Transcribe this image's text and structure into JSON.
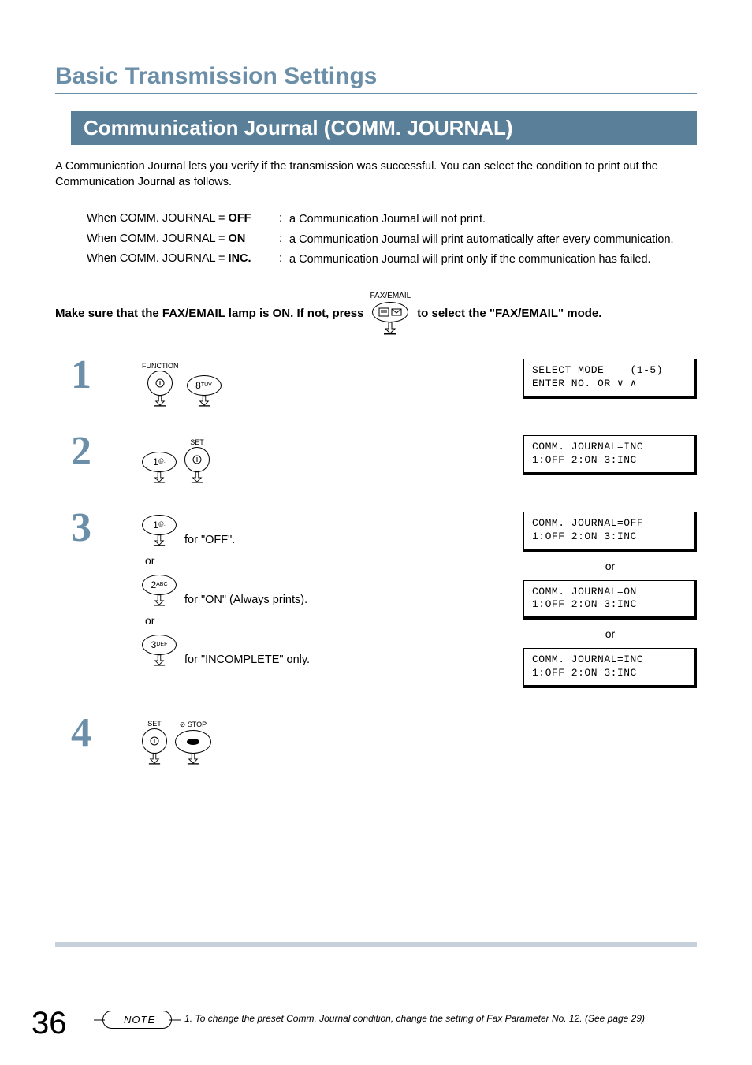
{
  "title": "Basic Transmission Settings",
  "section": "Communication Journal (COMM. JOURNAL)",
  "intro": "A Communication Journal lets you verify if the transmission was successful. You can select the condition to print out the Communication Journal as follows.",
  "conditions": [
    {
      "label_prefix": "When COMM. JOURNAL = ",
      "label_bold": "OFF",
      "desc": "a Communication Journal will not print."
    },
    {
      "label_prefix": "When COMM. JOURNAL = ",
      "label_bold": "ON",
      "desc": "a Communication Journal will print automatically after every communication."
    },
    {
      "label_prefix": "When COMM. JOURNAL = ",
      "label_bold": "INC.",
      "desc": "a Communication Journal will print only if the communication has failed."
    }
  ],
  "mode": {
    "part1": "Make sure that the FAX/EMAIL lamp is ON.  If not, press",
    "faxemail_label": "FAX/EMAIL",
    "part2": "to select the \"FAX/EMAIL\" mode."
  },
  "steps": {
    "s1": {
      "num": "1",
      "function_label": "FUNCTION",
      "key8": "8",
      "key8_sub": "TUV",
      "lcd1_l1": "SELECT MODE    (1-5)",
      "lcd1_l2": "ENTER NO. OR ∨ ∧"
    },
    "s2": {
      "num": "2",
      "key1": "1",
      "key1_sub": "@.",
      "set_label": "SET",
      "lcd_l1": "COMM. JOURNAL=INC",
      "lcd_l2": "1:OFF 2:ON 3:INC"
    },
    "s3": {
      "num": "3",
      "key1": "1",
      "key1_sub": "@.",
      "text1": "for \"OFF\".",
      "or": "or",
      "key2": "2",
      "key2_sub": "ABC",
      "text2": "for \"ON\" (Always prints).",
      "key3": "3",
      "key3_sub": "DEF",
      "text3": "for \"INCOMPLETE\" only.",
      "lcd_off_l1": "COMM. JOURNAL=OFF",
      "lcd_off_l2": "1:OFF 2:ON 3:INC",
      "lcd_on_l1": "COMM. JOURNAL=ON",
      "lcd_on_l2": "1:OFF 2:ON 3:INC",
      "lcd_inc_l1": "COMM. JOURNAL=INC",
      "lcd_inc_l2": "1:OFF 2:ON 3:INC"
    },
    "s4": {
      "num": "4",
      "set_label": "SET",
      "stop_label": "STOP"
    }
  },
  "note": {
    "pill": "NOTE",
    "text": "1. To change the preset Comm. Journal condition, change the setting of Fax Parameter No. 12. (See page 29)"
  },
  "page_number": "36"
}
